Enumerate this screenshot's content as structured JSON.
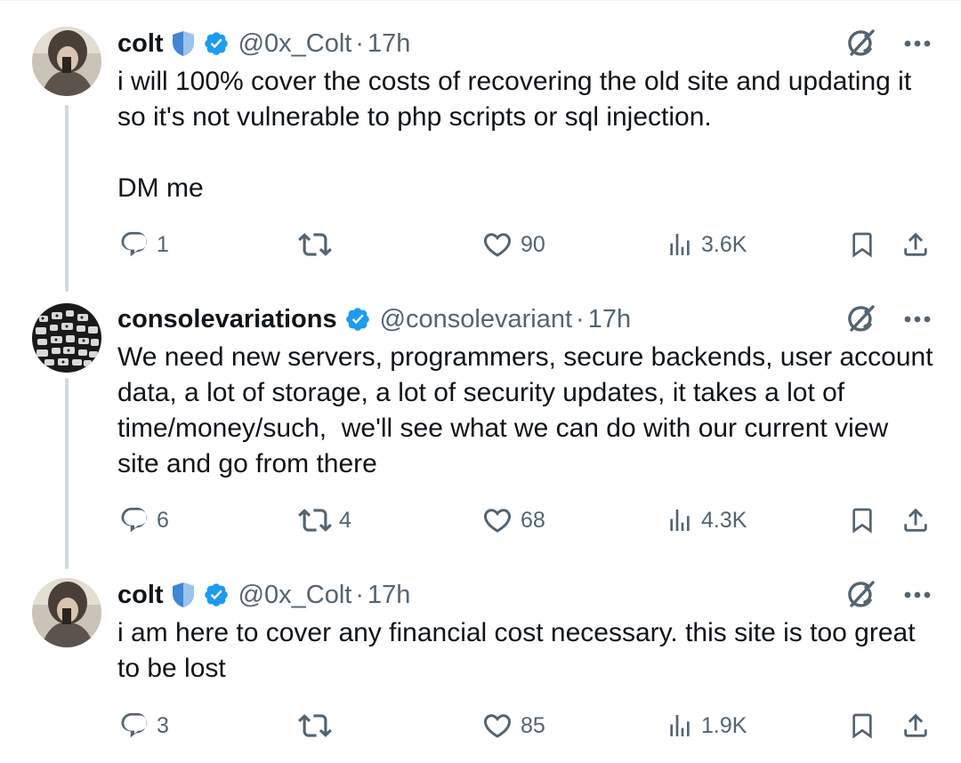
{
  "colors": {
    "verified": "#1d9bf0",
    "shield": "#3f86d6",
    "muted": "#536471",
    "text": "#0f1419",
    "thread_line": "#cfd9de"
  },
  "tweets": [
    {
      "name": "colt",
      "handle": "@0x_Colt",
      "separator": "·",
      "time": "17h",
      "text": "i will 100% cover the costs of recovering the old site and updating it so it's not vulnerable to php scripts or sql injection.\n\nDM me",
      "replies": "1",
      "reposts": "",
      "likes": "90",
      "views": "3.6K",
      "avatar": "colt-avatar",
      "badges": [
        "shield-icon",
        "verified-icon"
      ]
    },
    {
      "name": "consolevariations",
      "handle": "@consolevariant",
      "separator": "·",
      "time": "17h",
      "text": "We need new servers, programmers, secure backends, user account data, a lot of storage, a lot of security updates, it takes a lot of time/money/such,  we'll see what we can do with our current view site and go from there",
      "replies": "6",
      "reposts": "4",
      "likes": "68",
      "views": "4.3K",
      "avatar": "consolevariations-avatar",
      "badges": [
        "verified-icon"
      ]
    },
    {
      "name": "colt",
      "handle": "@0x_Colt",
      "separator": "·",
      "time": "17h",
      "text": "i am here to cover any financial cost necessary. this site is too great to be lost",
      "replies": "3",
      "reposts": "",
      "likes": "85",
      "views": "1.9K",
      "avatar": "colt-avatar",
      "badges": [
        "shield-icon",
        "verified-icon"
      ]
    }
  ]
}
